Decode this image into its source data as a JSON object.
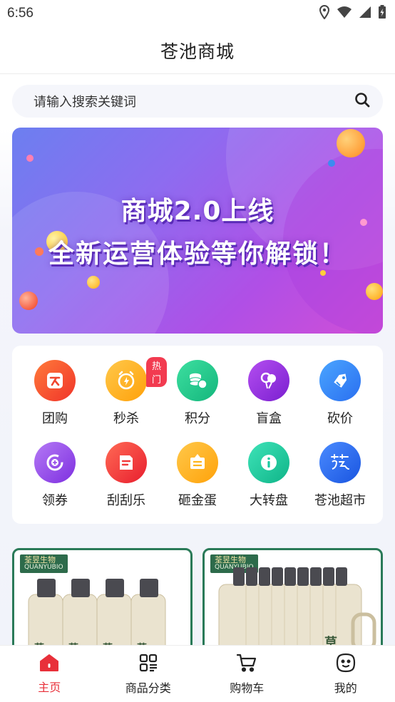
{
  "status": {
    "time": "6:56"
  },
  "header": {
    "title": "苍池商城"
  },
  "search": {
    "placeholder": "请输入搜索关键词"
  },
  "banner": {
    "line1": "商城2.0上线",
    "line2": "全新运营体验等你解锁！"
  },
  "grid": {
    "items": [
      {
        "label": "团购",
        "icon": "group-buy-icon",
        "color": "#f24a34"
      },
      {
        "label": "秒杀",
        "icon": "alarm-clock-icon",
        "color": "#ffb31a",
        "badge": "热门"
      },
      {
        "label": "积分",
        "icon": "coins-icon",
        "color": "#1fc48c"
      },
      {
        "label": "盲盒",
        "icon": "balloon-icon",
        "color": "#9b2fe0"
      },
      {
        "label": "砍价",
        "icon": "tag-icon",
        "color": "#2f8cf0"
      },
      {
        "label": "领券",
        "icon": "coupon-icon",
        "color": "#9140e8"
      },
      {
        "label": "刮刮乐",
        "icon": "scratch-card-icon",
        "color": "#f23a3a"
      },
      {
        "label": "砸金蛋",
        "icon": "golden-egg-icon",
        "color": "#ffb41c"
      },
      {
        "label": "大转盘",
        "icon": "info-wheel-icon",
        "color": "#18c9a0"
      },
      {
        "label": "苍池超市",
        "icon": "store-logo-icon",
        "color": "#2b6ff0"
      }
    ]
  },
  "products": [
    {
      "brand_cn": "荃昱生物",
      "brand_en": "QUANYUBIO"
    },
    {
      "brand_cn": "荃昱生物",
      "brand_en": "QUANYUBIO"
    }
  ],
  "tabbar": {
    "items": [
      {
        "label": "主页",
        "icon": "home-icon",
        "active": true
      },
      {
        "label": "商品分类",
        "icon": "category-icon",
        "active": false
      },
      {
        "label": "购物车",
        "icon": "cart-icon",
        "active": false
      },
      {
        "label": "我的",
        "icon": "profile-icon",
        "active": false
      }
    ]
  },
  "colors": {
    "accent": "#e8303a",
    "brand_green": "#2a7a58"
  }
}
